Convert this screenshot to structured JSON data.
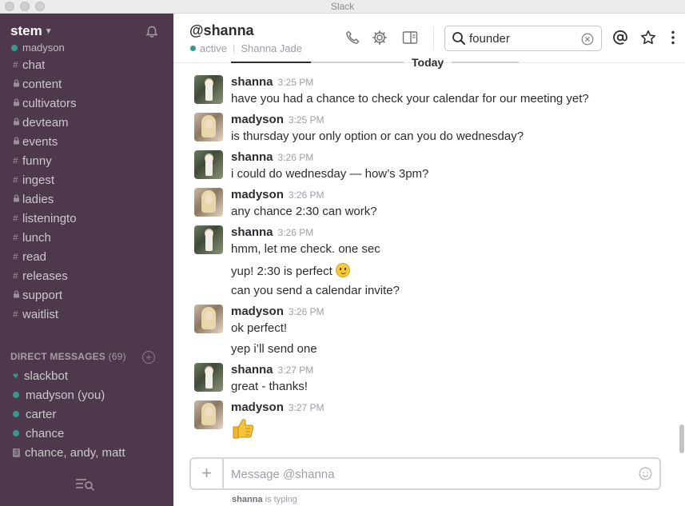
{
  "window": {
    "title": "Slack"
  },
  "sidebar": {
    "team_name": "stem",
    "current_user": "madyson",
    "channels": [
      {
        "prefix": "#",
        "name": "chat"
      },
      {
        "prefix": "lock",
        "name": "content"
      },
      {
        "prefix": "lock",
        "name": "cultivators"
      },
      {
        "prefix": "lock",
        "name": "devteam"
      },
      {
        "prefix": "lock",
        "name": "events"
      },
      {
        "prefix": "#",
        "name": "funny"
      },
      {
        "prefix": "#",
        "name": "ingest"
      },
      {
        "prefix": "lock",
        "name": "ladies"
      },
      {
        "prefix": "#",
        "name": "listeningto"
      },
      {
        "prefix": "#",
        "name": "lunch"
      },
      {
        "prefix": "#",
        "name": "read"
      },
      {
        "prefix": "#",
        "name": "releases"
      },
      {
        "prefix": "lock",
        "name": "support"
      },
      {
        "prefix": "#",
        "name": "waitlist"
      }
    ],
    "dm_header": "DIRECT MESSAGES",
    "dm_count": "(69)",
    "direct_messages": [
      {
        "status": "heart",
        "name": "slackbot"
      },
      {
        "status": "online",
        "name": "madyson (you)"
      },
      {
        "status": "online",
        "name": "carter"
      },
      {
        "status": "online",
        "name": "chance"
      },
      {
        "status": "group",
        "badge": "3",
        "name": "chance, andy, matt"
      }
    ]
  },
  "header": {
    "channel_title": "@shanna",
    "presence": "active",
    "full_name": "Shanna Jade",
    "search_value": "founder"
  },
  "messages": {
    "day_divider": "Today",
    "groups": [
      {
        "author": "shanna",
        "time": "3:25 PM",
        "avatar": "shanna",
        "lines": [
          "have you had a chance to check your calendar for our meeting yet?"
        ]
      },
      {
        "author": "madyson",
        "time": "3:25 PM",
        "avatar": "madyson",
        "lines": [
          "is thursday your only option or can you do wednesday?"
        ]
      },
      {
        "author": "shanna",
        "time": "3:26 PM",
        "avatar": "shanna",
        "lines": [
          "i could do wednesday — how’s 3pm?"
        ]
      },
      {
        "author": "madyson",
        "time": "3:26 PM",
        "avatar": "madyson",
        "lines": [
          "any chance 2:30 can work?"
        ]
      },
      {
        "author": "shanna",
        "time": "3:26 PM",
        "avatar": "shanna",
        "lines": [
          "hmm, let me check. one sec",
          "yup! 2:30 is perfect",
          "can you send a calendar invite?"
        ]
      },
      {
        "author": "madyson",
        "time": "3:26 PM",
        "avatar": "madyson",
        "lines": [
          "ok perfect!",
          "yep i’ll send one"
        ]
      },
      {
        "author": "shanna",
        "time": "3:27 PM",
        "avatar": "shanna",
        "lines": [
          "great - thanks!"
        ]
      },
      {
        "author": "madyson",
        "time": "3:27 PM",
        "avatar": "madyson",
        "lines": []
      }
    ]
  },
  "composer": {
    "placeholder": "Message @shanna",
    "typing_user": "shanna",
    "typing_text": " is typing"
  },
  "colors": {
    "sidebar_bg": "#4d394b",
    "presence_green": "#38978d",
    "text": "#2c2d30",
    "muted": "#9e9ea6"
  }
}
